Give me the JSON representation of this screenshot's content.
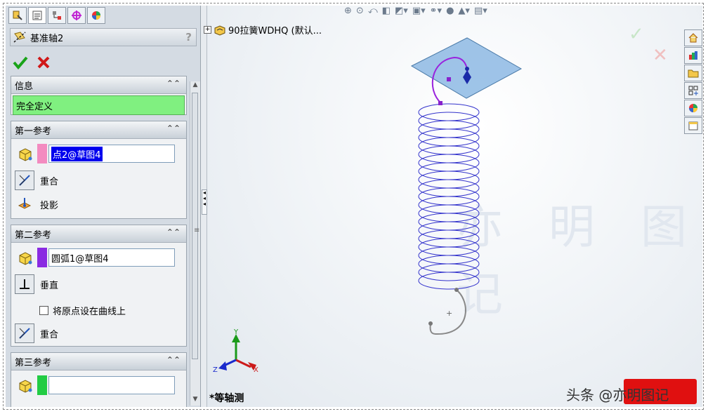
{
  "property_manager": {
    "title": "基准轴2",
    "help": "?",
    "tab_icons": [
      "feature-manager-icon",
      "property-manager-icon",
      "configuration-manager-icon",
      "dimxpert-icon",
      "display-manager-icon"
    ],
    "ok_icon": "check-icon",
    "cancel_icon": "x-icon"
  },
  "info_group": {
    "header": "信息",
    "status": "完全定义",
    "status_color": "#80f080"
  },
  "ref1": {
    "header": "第一参考",
    "selection": "点2@草图4",
    "swatch_color": "#f38bc0",
    "options": [
      "重合",
      "投影"
    ]
  },
  "ref2": {
    "header": "第二参考",
    "selection": "圆弧1@草图4",
    "swatch_color": "#8a2be2",
    "options": [
      "垂直",
      "重合"
    ],
    "checkbox_label": "将原点设在曲线上"
  },
  "ref3": {
    "header": "第三参考",
    "selection": "",
    "swatch_color": "#22cc44"
  },
  "tree_item": "90拉簧WDHQ  (默认...",
  "view_name": "*等轴测",
  "axis_labels": {
    "x": "X",
    "y": "Y",
    "z": "Z"
  },
  "watermark": "亦 明 图 记",
  "credit": "头条 @亦明图记"
}
